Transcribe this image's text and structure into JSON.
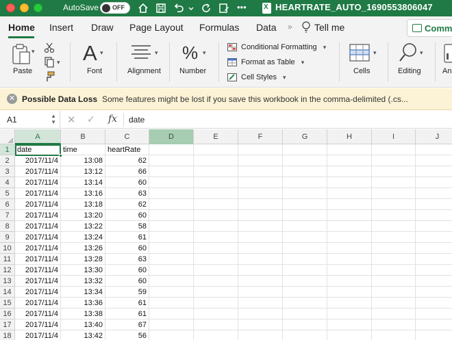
{
  "titlebar": {
    "autosave_label": "AutoSave",
    "autosave_state": "OFF",
    "file_title": "HEARTRATE_AUTO_1690553806047",
    "accent": "#1f7a45"
  },
  "ribbon_tabs": {
    "home": "Home",
    "insert": "Insert",
    "draw": "Draw",
    "page_layout": "Page Layout",
    "formulas": "Formulas",
    "data": "Data",
    "more": "»",
    "tell_me": "Tell me",
    "comments": "Comments"
  },
  "ribbon": {
    "paste": "Paste",
    "font": "Font",
    "alignment": "Alignment",
    "number": "Number",
    "conditional_formatting": "Conditional Formatting",
    "format_as_table": "Format as Table",
    "cell_styles": "Cell Styles",
    "cells": "Cells",
    "editing": "Editing",
    "analyze": "Ana..."
  },
  "message_bar": {
    "title": "Possible Data Loss",
    "text": "Some features might be lost if you save this workbook in the comma-delimited (.cs..."
  },
  "formula_bar": {
    "name_box": "A1",
    "cancel": "✕",
    "enter": "✓",
    "fx": "fx",
    "value": "date"
  },
  "columns": [
    "A",
    "B",
    "C",
    "D",
    "E",
    "F",
    "G",
    "H",
    "I",
    "J"
  ],
  "header_row": [
    "date",
    "time",
    "heartRate"
  ],
  "rows": [
    [
      "2017/11/4",
      "13:08",
      "62"
    ],
    [
      "2017/11/4",
      "13:12",
      "66"
    ],
    [
      "2017/11/4",
      "13:14",
      "60"
    ],
    [
      "2017/11/4",
      "13:16",
      "63"
    ],
    [
      "2017/11/4",
      "13:18",
      "62"
    ],
    [
      "2017/11/4",
      "13:20",
      "60"
    ],
    [
      "2017/11/4",
      "13:22",
      "58"
    ],
    [
      "2017/11/4",
      "13:24",
      "61"
    ],
    [
      "2017/11/4",
      "13:26",
      "60"
    ],
    [
      "2017/11/4",
      "13:28",
      "63"
    ],
    [
      "2017/11/4",
      "13:30",
      "60"
    ],
    [
      "2017/11/4",
      "13:32",
      "60"
    ],
    [
      "2017/11/4",
      "13:34",
      "59"
    ],
    [
      "2017/11/4",
      "13:36",
      "61"
    ],
    [
      "2017/11/4",
      "13:38",
      "61"
    ],
    [
      "2017/11/4",
      "13:40",
      "67"
    ],
    [
      "2017/11/4",
      "13:42",
      "56"
    ]
  ],
  "row_numbers": [
    "1",
    "2",
    "3",
    "4",
    "5",
    "6",
    "7",
    "8",
    "9",
    "10",
    "11",
    "12",
    "13",
    "14",
    "15",
    "16",
    "17",
    "18"
  ]
}
